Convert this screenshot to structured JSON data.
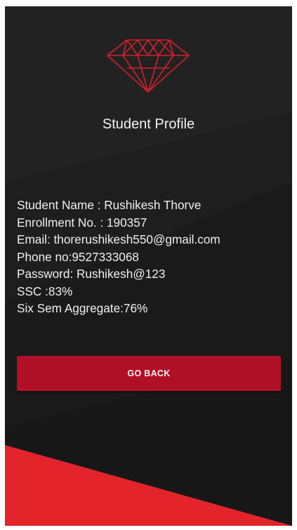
{
  "colors": {
    "background": "#1e1e1f",
    "accent": "#b01026",
    "bottom_shape": "#e3242b",
    "text": "#f0f0f0"
  },
  "logo": {
    "icon": "diamond-icon"
  },
  "profile": {
    "title": "Student Profile",
    "fields": [
      "Student Name : Rushikesh Thorve",
      "Enrollment No. : 190357",
      "Email: thorerushikesh550@gmail.com",
      "Phone no:9527333068",
      "Password: Rushikesh@123",
      "SSC :83%",
      "Six Sem Aggregate:76%"
    ]
  },
  "actions": {
    "go_back_label": "GO BACK"
  }
}
